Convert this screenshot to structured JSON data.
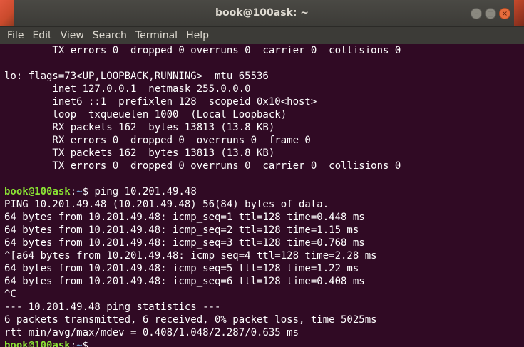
{
  "window": {
    "title": "book@100ask: ~",
    "controls": {
      "minimize": "–",
      "maximize": "□",
      "close": "×"
    }
  },
  "menubar": {
    "items": [
      "File",
      "Edit",
      "View",
      "Search",
      "Terminal",
      "Help"
    ]
  },
  "terminal": {
    "prompt_user": "book@100ask",
    "prompt_sep": ":",
    "prompt_path": "~",
    "prompt_symbol": "$ ",
    "lines": [
      "        TX errors 0  dropped 0 overruns 0  carrier 0  collisions 0",
      "",
      "lo: flags=73<UP,LOOPBACK,RUNNING>  mtu 65536",
      "        inet 127.0.0.1  netmask 255.0.0.0",
      "        inet6 ::1  prefixlen 128  scopeid 0x10<host>",
      "        loop  txqueuelen 1000  (Local Loopback)",
      "        RX packets 162  bytes 13813 (13.8 KB)",
      "        RX errors 0  dropped 0  overruns 0  frame 0",
      "        TX packets 162  bytes 13813 (13.8 KB)",
      "        TX errors 0  dropped 0 overruns 0  carrier 0  collisions 0",
      ""
    ],
    "command": "ping 10.201.49.48",
    "output": [
      "PING 10.201.49.48 (10.201.49.48) 56(84) bytes of data.",
      "64 bytes from 10.201.49.48: icmp_seq=1 ttl=128 time=0.448 ms",
      "64 bytes from 10.201.49.48: icmp_seq=2 ttl=128 time=1.15 ms",
      "64 bytes from 10.201.49.48: icmp_seq=3 ttl=128 time=0.768 ms",
      "^[a64 bytes from 10.201.49.48: icmp_seq=4 ttl=128 time=2.28 ms",
      "64 bytes from 10.201.49.48: icmp_seq=5 ttl=128 time=1.22 ms",
      "64 bytes from 10.201.49.48: icmp_seq=6 ttl=128 time=0.408 ms",
      "^C",
      "--- 10.201.49.48 ping statistics ---",
      "6 packets transmitted, 6 received, 0% packet loss, time 5025ms",
      "rtt min/avg/max/mdev = 0.408/1.048/2.287/0.635 ms"
    ],
    "final_prompt_symbol": "$"
  },
  "colors": {
    "terminal_bg": "#300a24",
    "prompt_user": "#8ae234",
    "prompt_path": "#729fcf",
    "titlebar": "#3c3b37",
    "close_button": "#e66c3c"
  }
}
